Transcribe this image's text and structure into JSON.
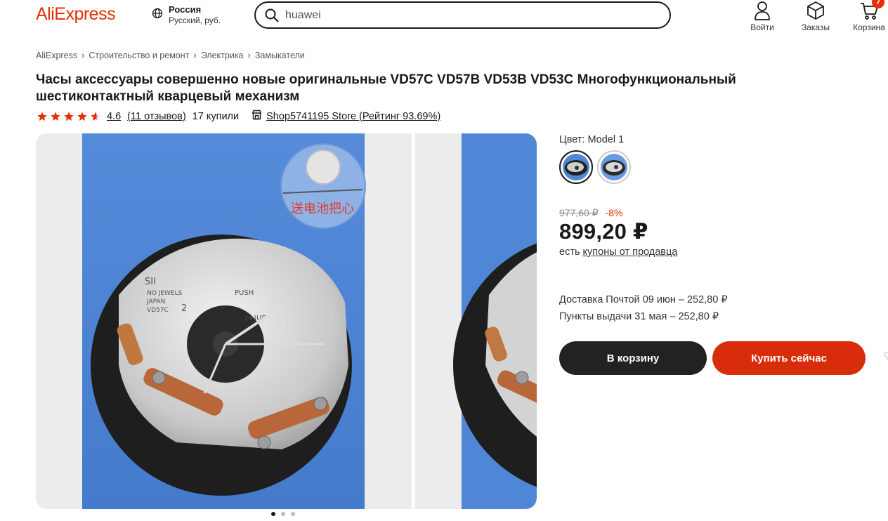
{
  "header": {
    "logo": "AliExpress",
    "region_title": "Россия",
    "region_sub": "Русский, руб.",
    "search_value": "huawei",
    "login_label": "Войти",
    "orders_label": "Заказы",
    "cart_label": "Корзина",
    "cart_count": "7"
  },
  "breadcrumb": [
    "AliExpress",
    "Строительство и ремонт",
    "Электрика",
    "Замыкатели"
  ],
  "product": {
    "title": "Часы аксессуары совершенно новые оригинальные VD57C VD57B VD53B VD53C Многофункциональный шестиконтактный кварцевый механизм",
    "rating": "4.6",
    "rating_value": 4.6,
    "reviews": "(11 отзывов)",
    "bought": "17 купили",
    "store": "Shop5741195 Store (Рейтинг 93.69%)"
  },
  "gallery": {
    "watermark_text": "送电池把心",
    "image_texts": [
      "SII",
      "NO JEWELS",
      "JAPAN",
      "VD57C",
      "2",
      "PUSH",
      "(+)UP"
    ],
    "slide_count": 3,
    "active_slide": 1
  },
  "options": {
    "color_label": "Цвет: Model 1",
    "swatch_count": 2,
    "selected": 0
  },
  "pricing": {
    "old_price": "977,60 ₽",
    "discount": "-8%",
    "price": "899,20 ₽",
    "coupon_prefix": "есть",
    "coupon_link": "купоны от продавца"
  },
  "delivery": {
    "line1": "Доставка Почтой 09 июн – 252,80 ₽",
    "line2": "Пункты выдачи 31 мая – 252,80 ₽"
  },
  "actions": {
    "add_to_cart": "В корзину",
    "buy_now": "Купить сейчас"
  },
  "colors": {
    "brand": "#e62e04",
    "buy_button": "#d82c0b",
    "cart_button": "#222222",
    "photo_bg": "#4f86d6"
  }
}
